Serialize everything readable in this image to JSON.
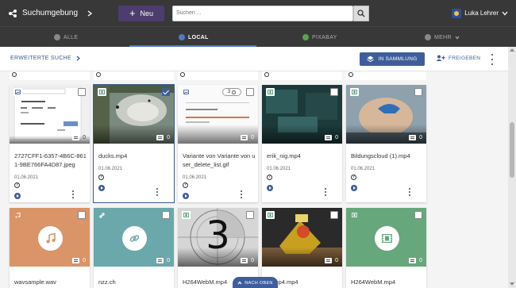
{
  "header": {
    "brand_label": "Suchumgebung",
    "new_button_label": "Neu",
    "search_placeholder": "Suchen ...",
    "user_name": "Luka Lehrer"
  },
  "tabs": [
    {
      "label": "ALLE",
      "active": false
    },
    {
      "label": "LOCAL",
      "active": true
    },
    {
      "label": "PIXABAY",
      "active": false
    },
    {
      "label": "MEHR",
      "active": false
    }
  ],
  "subbar": {
    "advanced_search_label": "ERWEITERTE SUCHE",
    "collection_button_label": "IN SAMMLUNG",
    "share_button_label": "FREIGEBEN"
  },
  "cards_row1": [
    {
      "title": "2727CFF1-6357-4B6C-8611-9BE766FA4D87.jpeg",
      "date": "01.06.2021",
      "comments": "0",
      "type_icon": "image-icon",
      "selected": false
    },
    {
      "title": "ducks.mp4",
      "date": "01.06.2021",
      "comments": "0",
      "type_icon": "video-icon",
      "selected": true
    },
    {
      "title": "Variante von Variante von user_delete_list.gif",
      "date": "01.06.2021",
      "comments": "0",
      "versions": "3",
      "type_icon": "image-icon",
      "selected": false
    },
    {
      "title": "erik_nig.mp4",
      "date": "01.06.2021",
      "comments": "0",
      "type_icon": "video-icon",
      "selected": false
    },
    {
      "title": "Bildungscloud (1).mp4",
      "date": "01.06.2021",
      "comments": "0",
      "type_icon": "video-icon",
      "selected": false
    }
  ],
  "cards_row2": [
    {
      "title": "wavsample.wav",
      "comments": "0",
      "type_icon": "audio-icon"
    },
    {
      "title": "nzz.ch",
      "comments": "0",
      "type_icon": "link-icon"
    },
    {
      "title": "H264WebM.mp4",
      "comments": "0",
      "type_icon": "video-icon",
      "countdown": "3"
    },
    {
      "title": "Lamp4.mp4",
      "comments": "0",
      "type_icon": "video-icon"
    },
    {
      "title": "H264WebM.mp4",
      "comments": "0",
      "type_icon": "video-icon"
    }
  ],
  "back_to_top_label": "NACH OBEN",
  "colors": {
    "header_bg": "#383838",
    "accent": "#3e5d9b",
    "new_button": "#4d3d6e",
    "audio_card": "#d99468",
    "link_card": "#6aa8ab",
    "video_card": "#67a77c"
  }
}
